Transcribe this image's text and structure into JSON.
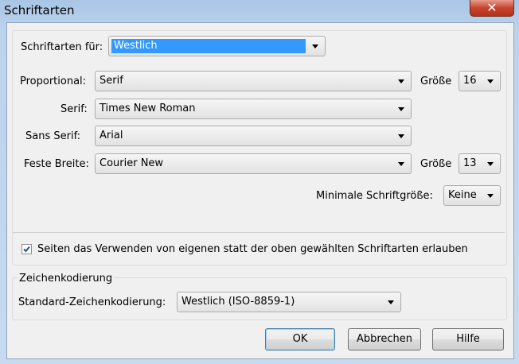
{
  "window": {
    "title": "Schriftarten",
    "close_glyph": "✕"
  },
  "fonts_for": {
    "label": "Schriftarten für:",
    "value": "Westlich"
  },
  "proportional": {
    "label": "Proportional:",
    "value": "Serif",
    "size_label": "Größe",
    "size_value": "16"
  },
  "serif": {
    "label": "Serif:",
    "value": "Times New Roman"
  },
  "sans_serif": {
    "label": "Sans Serif:",
    "value": "Arial"
  },
  "fixed_width": {
    "label": "Feste Breite:",
    "value": "Courier New",
    "size_label": "Größe",
    "size_value": "13"
  },
  "min_font_size": {
    "label": "Minimale Schriftgröße:",
    "value": "Keine"
  },
  "allow_page_fonts": {
    "label": "Seiten das Verwenden von eigenen statt der oben gewählten Schriftarten erlauben",
    "checked": true
  },
  "encoding": {
    "group_label": "Zeichenkodierung",
    "label": "Standard-Zeichenkodierung:",
    "value": "Westlich (ISO-8859-1)"
  },
  "buttons": {
    "ok": "OK",
    "cancel": "Abbrechen",
    "help": "Hilfe"
  },
  "colors": {
    "selection": "#3399ff",
    "checkmark": "#2a4c9a"
  }
}
